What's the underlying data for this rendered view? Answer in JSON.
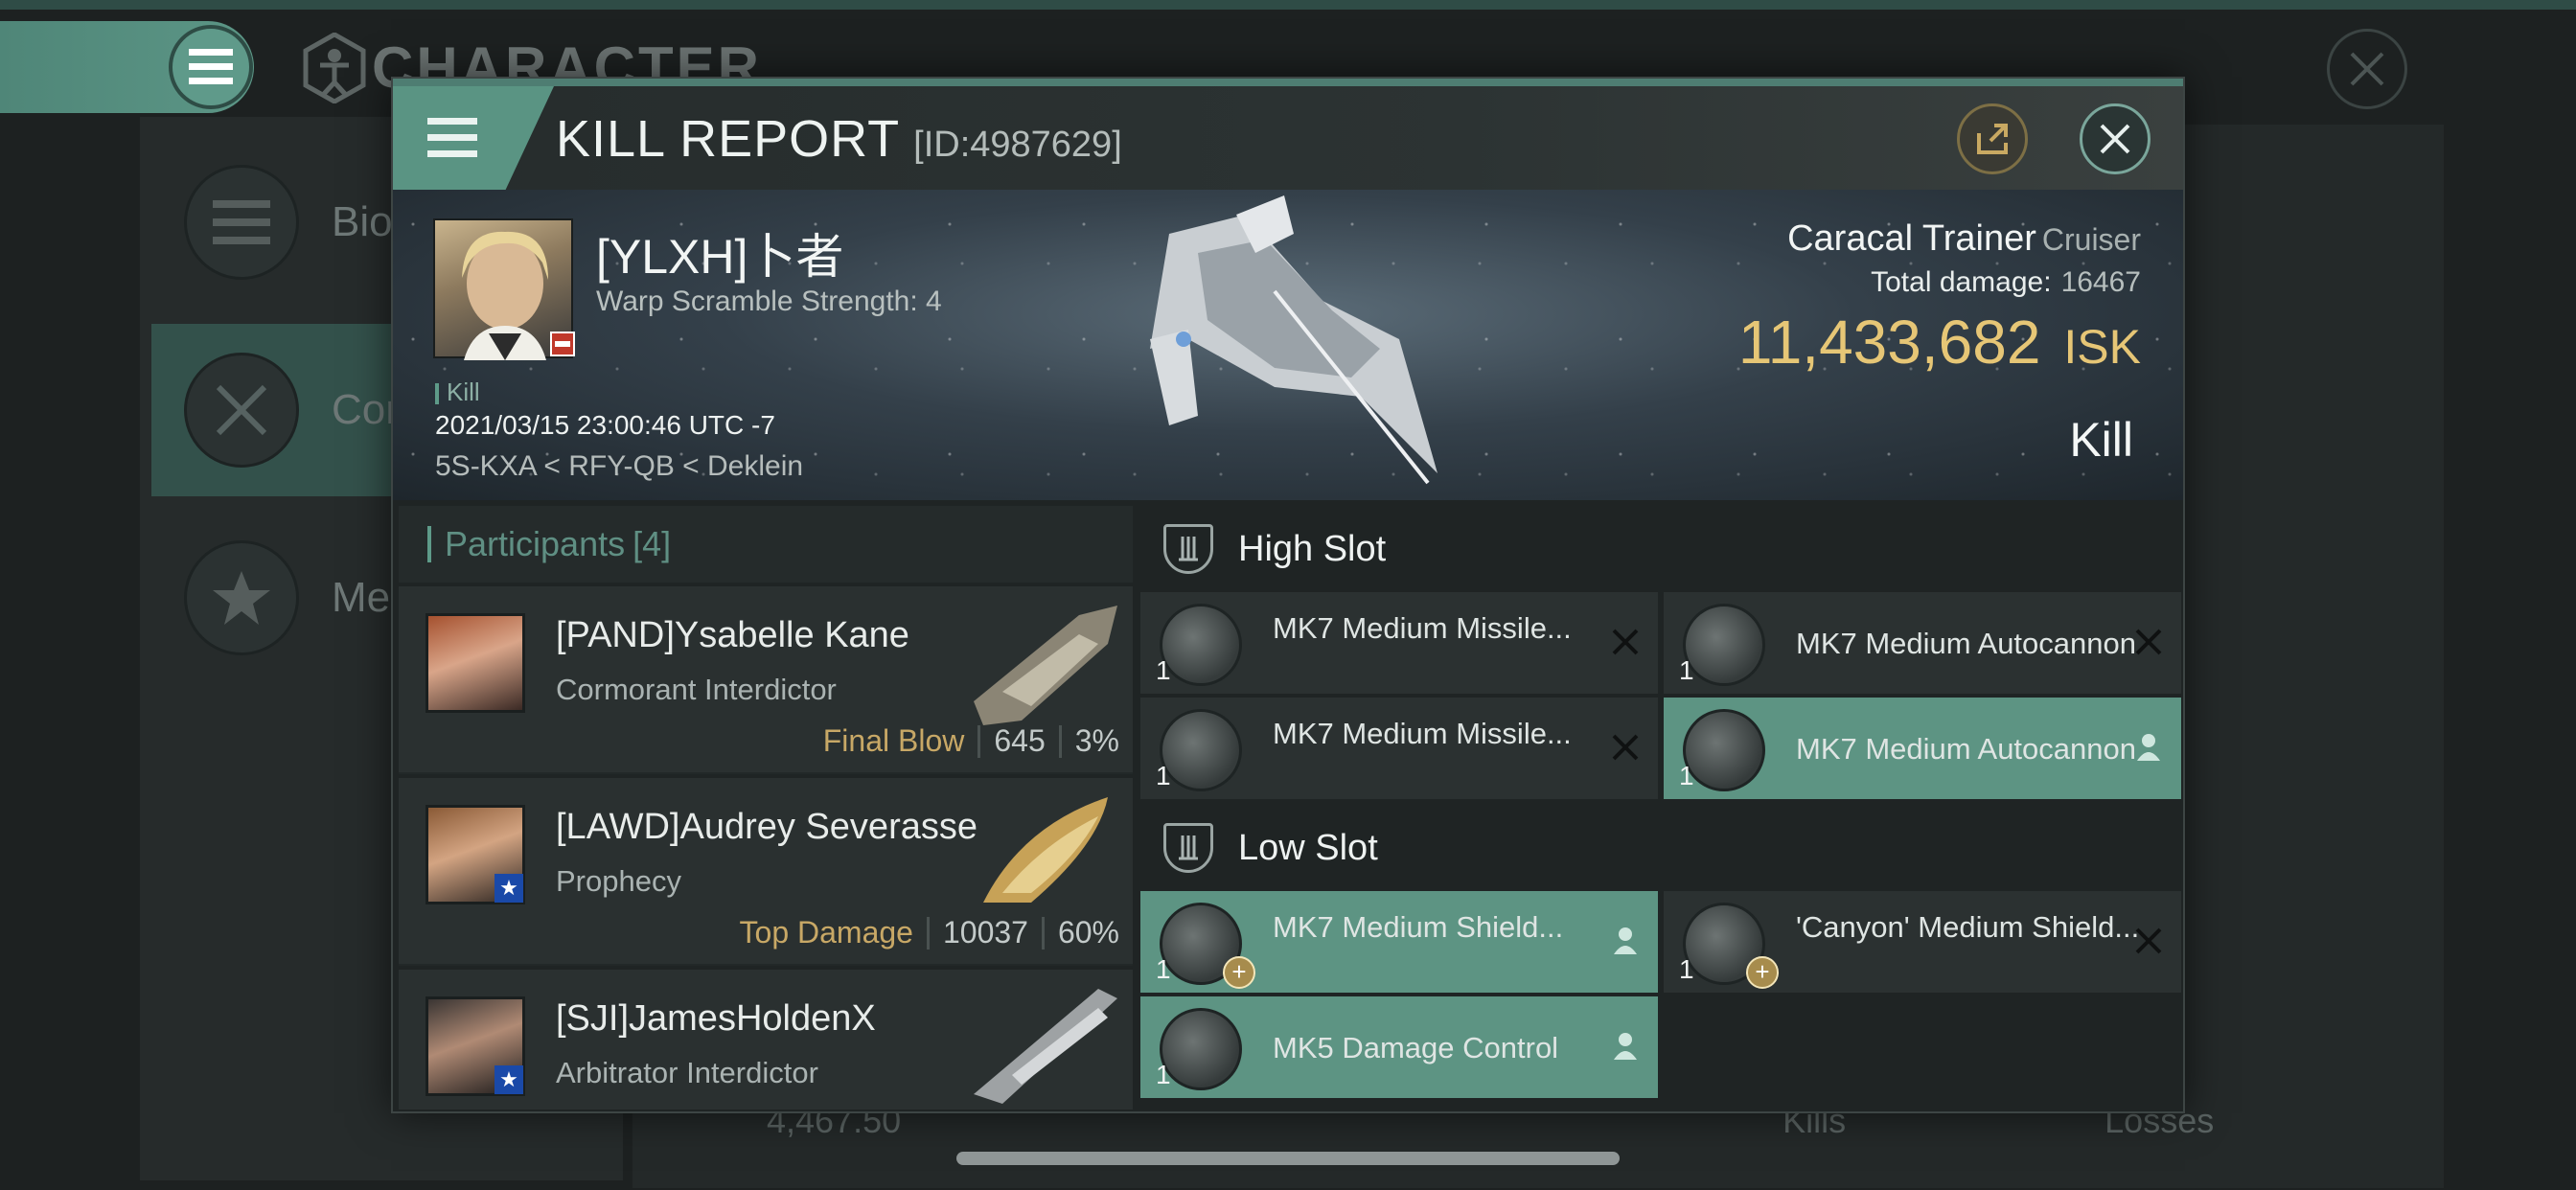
{
  "background": {
    "title": "CHARACTER",
    "sidebar": [
      {
        "label": "Bio"
      },
      {
        "label": "Con"
      },
      {
        "label": "Med"
      }
    ],
    "bottom": {
      "value": "4,467.50",
      "kills_label": "Kills",
      "losses_label": "Losses"
    }
  },
  "modal": {
    "title": "KILL REPORT",
    "id": "[ID:4987629]"
  },
  "victim": {
    "name": "[YLXH]卜者",
    "subtitle": "Warp Scramble Strength: 4",
    "tag": "Kill",
    "time": "2021/03/15 23:00:46 UTC -7",
    "location": "5S-KXA < RFY-QB < Deklein"
  },
  "ship": {
    "name": "Caracal Trainer",
    "class": "Cruiser",
    "total_damage_label": "Total damage:",
    "total_damage": "16467",
    "isk_value": "11,433,682",
    "isk_unit": "ISK",
    "result": "Kill"
  },
  "participants": {
    "label": "Participants",
    "count": "[4]",
    "rows": [
      {
        "name": "[PAND]Ysabelle Kane",
        "ship": "Cormorant Interdictor",
        "stat_label": "Final Blow",
        "damage": "645",
        "percent": "3%"
      },
      {
        "name": "[LAWD]Audrey Severasse",
        "ship": "Prophecy",
        "stat_label": "Top Damage",
        "damage": "10037",
        "percent": "60%"
      },
      {
        "name": "[SJI]JamesHoldenX",
        "ship": "Arbitrator Interdictor",
        "stat_label": "",
        "damage": "",
        "percent": ""
      }
    ]
  },
  "slots": {
    "high": {
      "label": "High Slot",
      "modules": [
        {
          "qty": "1",
          "name": "MK7 Medium Missile..."
        },
        {
          "qty": "1",
          "name": "MK7 Medium Autocannon"
        },
        {
          "qty": "1",
          "name": "MK7 Medium Missile..."
        },
        {
          "qty": "1",
          "name": "MK7 Medium Autocannon"
        }
      ]
    },
    "low": {
      "label": "Low Slot",
      "modules": [
        {
          "qty": "1",
          "name": "MK7 Medium Shield..."
        },
        {
          "qty": "1",
          "name": "'Canyon' Medium Shield..."
        },
        {
          "qty": "1",
          "name": "MK5 Damage Control"
        }
      ]
    }
  },
  "colors": {
    "accent": "#5d9483",
    "isk": "#e6c676",
    "stat_label": "#c8a866"
  }
}
